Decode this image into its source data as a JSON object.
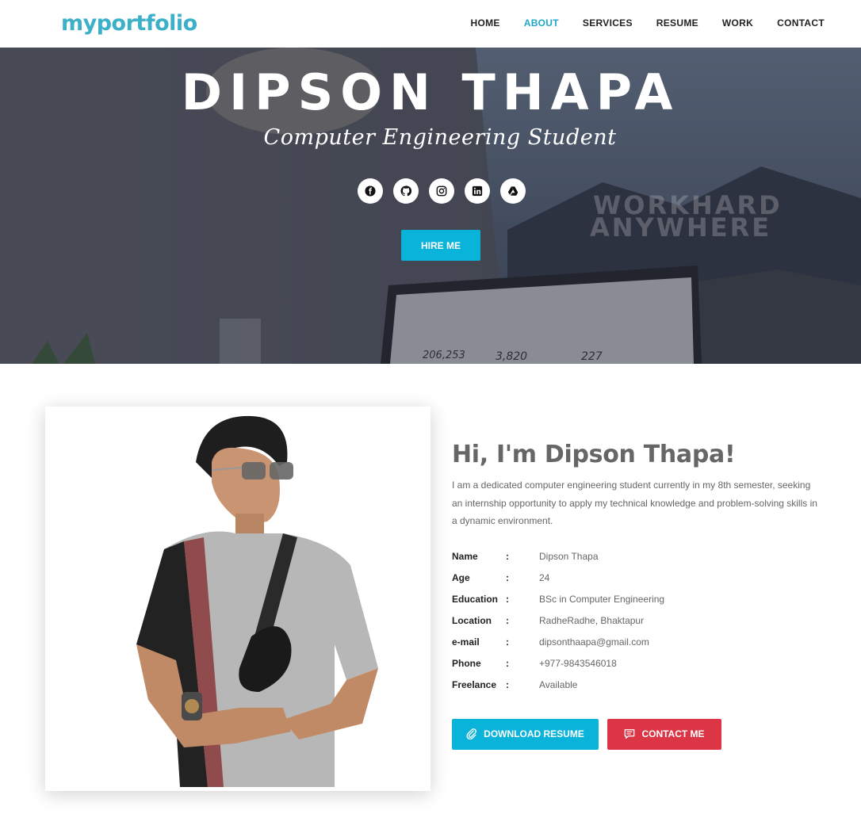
{
  "navbar": {
    "logo": "myportfolio",
    "links": [
      "HOME",
      "ABOUT",
      "SERVICES",
      "RESUME",
      "WORK",
      "CONTACT"
    ],
    "active": "ABOUT"
  },
  "hero": {
    "title": "DIPSON THAPA",
    "subtitle": "Computer Engineering Student",
    "social_icons": [
      "facebook-icon",
      "github-icon",
      "instagram-icon",
      "linkedin-icon",
      "google-drive-icon"
    ],
    "hire_label": "HIRE ME",
    "background_text": [
      "WORKHARD",
      "ANYWHERE"
    ],
    "background_stats": [
      "206,253",
      "3,820",
      "227"
    ]
  },
  "about": {
    "heading": "Hi, I'm Dipson Thapa!",
    "description": "I am a dedicated computer engineering student currently in my 8th semester, seeking an internship opportunity to apply my technical knowledge and problem-solving skills in a dynamic environment.",
    "colon": ":",
    "info": [
      {
        "label": "Name",
        "value": "Dipson Thapa"
      },
      {
        "label": "Age",
        "value": "24"
      },
      {
        "label": "Education",
        "value": "BSc in Computer Engineering"
      },
      {
        "label": "Location",
        "value": "RadheRadhe, Bhaktapur"
      },
      {
        "label": "e-mail",
        "value": "dipsonthaapa@gmail.com"
      },
      {
        "label": "Phone",
        "value": "+977-9843546018"
      },
      {
        "label": "Freelance",
        "value": "Available"
      }
    ],
    "download_label": "DOWNLOAD RESUME",
    "contact_label": "CONTACT ME"
  },
  "colors": {
    "accent": "#0ab3d9",
    "nav_active": "#1da6c8",
    "contact_button": "#dc3545",
    "logo": "#3cb0c8"
  }
}
